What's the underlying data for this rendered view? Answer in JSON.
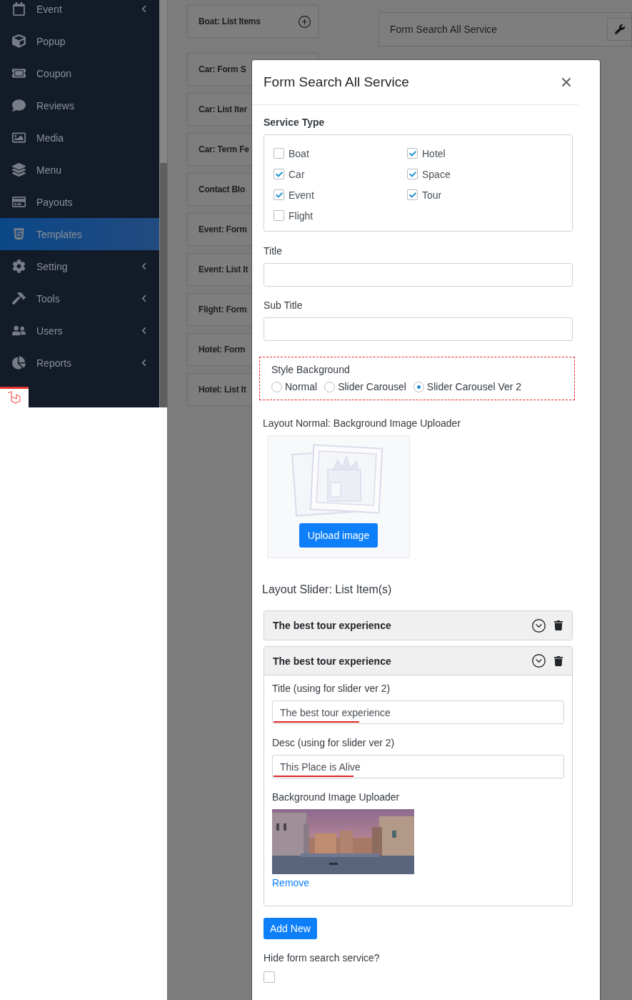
{
  "sidebar": {
    "items": [
      {
        "label": "Event",
        "expandable": true,
        "selected": false
      },
      {
        "label": "Popup",
        "expandable": false,
        "selected": false
      },
      {
        "label": "Coupon",
        "expandable": false,
        "selected": false
      },
      {
        "label": "Reviews",
        "expandable": false,
        "selected": false
      },
      {
        "label": "Media",
        "expandable": false,
        "selected": false
      },
      {
        "label": "Menu",
        "expandable": false,
        "selected": false
      },
      {
        "label": "Payouts",
        "expandable": false,
        "selected": false
      },
      {
        "label": "Templates",
        "expandable": false,
        "selected": true
      },
      {
        "label": "Setting",
        "expandable": true,
        "selected": false
      },
      {
        "label": "Tools",
        "expandable": true,
        "selected": false
      },
      {
        "label": "Users",
        "expandable": true,
        "selected": false
      },
      {
        "label": "Reports",
        "expandable": true,
        "selected": false
      }
    ]
  },
  "template_list": {
    "items": [
      {
        "label": "Boat: List Items",
        "kind": "addable"
      },
      {
        "label": "Car: Form S",
        "kind": "plain"
      },
      {
        "label": "Car: List Iter",
        "kind": "plain"
      },
      {
        "label": "Car: Term Fe",
        "kind": "plain"
      },
      {
        "label": "Contact Blo",
        "kind": "plain"
      },
      {
        "label": "Event: Form",
        "kind": "plain"
      },
      {
        "label": "Event: List It",
        "kind": "plain"
      },
      {
        "label": "Flight: Form",
        "kind": "plain"
      },
      {
        "label": "Hotel: Form",
        "kind": "plain"
      },
      {
        "label": "Hotel: List It",
        "kind": "plain"
      }
    ]
  },
  "page_card": {
    "title": "Form Search All Service"
  },
  "modal": {
    "title": "Form Search All Service",
    "service_type": {
      "label": "Service Type",
      "options": [
        {
          "label": "Boat",
          "checked": false
        },
        {
          "label": "Car",
          "checked": true
        },
        {
          "label": "Event",
          "checked": true
        },
        {
          "label": "Flight",
          "checked": false
        },
        {
          "label": "Hotel",
          "checked": true
        },
        {
          "label": "Space",
          "checked": true
        },
        {
          "label": "Tour",
          "checked": true
        }
      ]
    },
    "title_field": {
      "label": "Title"
    },
    "subtitle_field": {
      "label": "Sub Title"
    },
    "style_background": {
      "label": "Style Background",
      "options": [
        {
          "label": "Normal",
          "selected": false
        },
        {
          "label": "Slider Carousel",
          "selected": false
        },
        {
          "label": "Slider Carousel Ver 2",
          "selected": true
        }
      ]
    },
    "normal_uploader": {
      "label": "Layout Normal: Background Image Uploader",
      "button": "Upload image"
    },
    "slider_items": {
      "label": "Layout Slider: List Item(s)",
      "items": [
        {
          "heading": "The best tour experience",
          "expanded": false
        },
        {
          "heading": "The best tour experience",
          "expanded": true,
          "title_label": "Title (using for slider ver 2)",
          "title_value": "The best tour experience",
          "desc_label": "Desc (using for slider ver 2)",
          "desc_value": "This Place is Alive",
          "image_label": "Background Image Uploader",
          "remove_link": "Remove"
        }
      ]
    },
    "add_button": "Add New",
    "hide_option": {
      "label": "Hide form search service?",
      "checked": false
    }
  }
}
